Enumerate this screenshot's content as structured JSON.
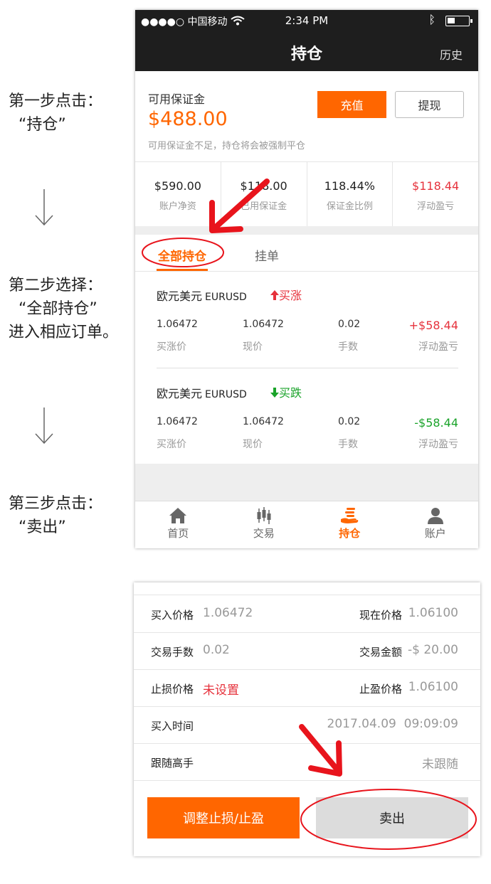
{
  "instructions": {
    "step1": {
      "line1": "第一步点击：",
      "line2": "“持仓”"
    },
    "step2": {
      "line1": "第二步选择：",
      "line2": "“全部持仓”",
      "line3": "进入相应订单。"
    },
    "step3": {
      "line1": "第三步点击：",
      "line2": "“卖出”"
    }
  },
  "status_bar": {
    "carrier": "●●●●○ 中国移动",
    "time": "2:34 PM"
  },
  "nav": {
    "title": "持仓",
    "history_label": "历史"
  },
  "margin": {
    "label": "可用保证金",
    "amount": "$488.00",
    "note": "可用保证金不足，持仓将会被强制平仓",
    "recharge_label": "充值",
    "withdraw_label": "提现"
  },
  "stats": [
    {
      "value": "$590.00",
      "label": "账户净资"
    },
    {
      "value": "$118.00",
      "label": "已用保证金"
    },
    {
      "value": "118.44%",
      "label": "保证金比例"
    },
    {
      "value": "$118.44",
      "label": "浮动盈亏"
    }
  ],
  "tabs": {
    "all": "全部持仓",
    "pending": "挂单"
  },
  "positions": [
    {
      "name": "欧元美元",
      "symbol": "EURUSD",
      "direction": "买涨",
      "buy_price": "1.06472",
      "buy_price_label": "买涨价",
      "current_price": "1.06472",
      "current_price_label": "现价",
      "lots": "0.02",
      "lots_label": "手数",
      "pnl": "+$58.44",
      "pnl_label": "浮动盈亏"
    },
    {
      "name": "欧元美元",
      "symbol": "EURUSD",
      "direction": "买跌",
      "buy_price": "1.06472",
      "buy_price_label": "买涨价",
      "current_price": "1.06472",
      "current_price_label": "现价",
      "lots": "0.02",
      "lots_label": "手数",
      "pnl": "-$58.44",
      "pnl_label": "浮动盈亏"
    }
  ],
  "tabbar": [
    {
      "label": "首页",
      "icon": "home-icon"
    },
    {
      "label": "交易",
      "icon": "candlestick-icon"
    },
    {
      "label": "持仓",
      "icon": "coins-hand-icon"
    },
    {
      "label": "账户",
      "icon": "user-icon"
    }
  ],
  "order_detail": {
    "buy_price_key": "买入价格",
    "buy_price": "1.06472",
    "current_price_key": "现在价格",
    "current_price": "1.06100",
    "lots_key": "交易手数",
    "lots": "0.02",
    "amount_key": "交易金额",
    "amount": "-$ 20.00",
    "stop_loss_key": "止损价格",
    "stop_loss": "未设置",
    "take_profit_key": "止盈价格",
    "take_profit": "1.06100",
    "buy_time_key": "买入时间",
    "buy_time": "2017.04.09  09:09:09",
    "follow_key": "跟随高手",
    "follow": "未跟随",
    "adjust_label": "调整止损/止盈",
    "sell_label": "卖出"
  },
  "colors": {
    "accent": "#ff6600",
    "up": "#e6323c",
    "down": "#1aa32a",
    "annotation": "#e8141c"
  }
}
